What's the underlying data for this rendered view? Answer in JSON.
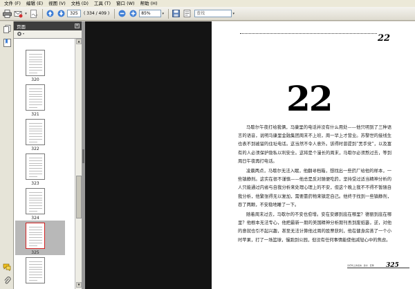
{
  "menu": [
    "文件 (F)",
    "编辑 (E)",
    "视图 (V)",
    "文档 (D)",
    "工具 (T)",
    "窗口 (W)",
    "帮助 (H)"
  ],
  "toolbar": {
    "current_page": "325",
    "page_count": "( 334 / 409 )",
    "zoom": "85%",
    "search_placeholder": "查找"
  },
  "panel": {
    "title": "页面",
    "close_glyph": "×"
  },
  "thumbnails": [
    {
      "label": "320"
    },
    {
      "label": "321"
    },
    {
      "label": "322"
    },
    {
      "label": "323"
    },
    {
      "label": "324"
    },
    {
      "label": "325"
    },
    {
      "label": ""
    }
  ],
  "document": {
    "running_page": "22",
    "chapter_number": "22",
    "paragraphs": [
      "马歇尔午夜打给我俩，马康里的电话并没有什么用处——他只明到了三种语言的语音，说明马康里金融集团周末不上班，周一早上才营业。苏黎世的接线生也表不到被留的住址电话。这当然不令人意外。该得时曾提到“黑手党”，以及富有的人必须保护隐私以利安全。这将是个漫长的周末，马歇尔必须熬过去，等到周日午夜再打电话。",
      "凌晨两点，马歇尔无法入眠，他翻寻档箱，想找出一些药厂给他的样本，一些镇静剂。这实在很不谨慎——他总是反对随便吃药，坚持受过适当精神分析的人只能通过内省与自我分析来处理心理上的不安，但这个晚上我不不得不暂随自我分析，他繁张得无以复加，需要靠药物来镇定自己。他终于找到一些镇静剂，吞了两颗，不安稳地睡了一下。",
      "随着周末过去，马歇尔的不安也愈增。安在安娜到底在哪里？德丽到底在哪里？他根本无法专心，他把最新一期的美国精神分析期刊丢到废纸篓，逆，对他的意就也引不起兴趣，甚至无法计算他过周的股票获利，他在健身房蒸了一个小时苹果，打了一场篮球，慢跑到公园，但没有任何事情能使他减轻心中的焦虑。"
    ],
    "footer_page": "325",
    "footer_text": "诊疗椅上的谎言 · 欧文 · 亚隆"
  }
}
